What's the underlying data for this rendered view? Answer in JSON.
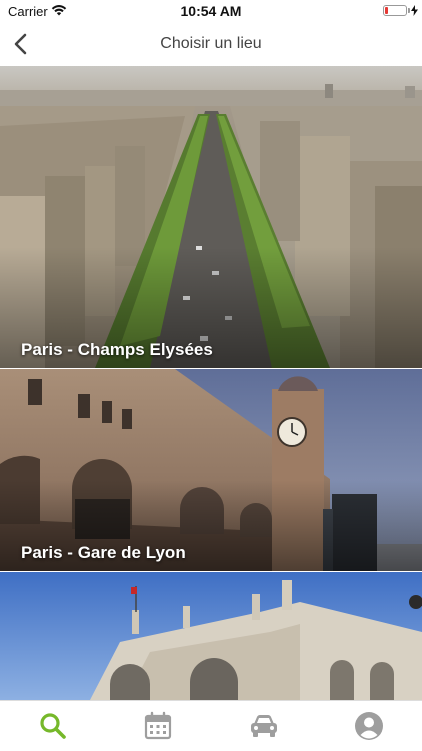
{
  "status_bar": {
    "carrier": "Carrier",
    "time": "10:54 AM",
    "battery_level": 0.1
  },
  "nav": {
    "title": "Choisir un lieu",
    "back_icon": "chevron-left-icon"
  },
  "places": [
    {
      "label": "Paris - Champs Elysées"
    },
    {
      "label": "Paris - Gare de Lyon"
    },
    {
      "label": ""
    }
  ],
  "tabs": [
    {
      "name": "search",
      "icon": "search-icon",
      "active": true
    },
    {
      "name": "calendar",
      "icon": "calendar-icon",
      "active": false
    },
    {
      "name": "car",
      "icon": "car-icon",
      "active": false
    },
    {
      "name": "profile",
      "icon": "profile-icon",
      "active": false
    }
  ],
  "colors": {
    "accent": "#76b82a",
    "tab_inactive": "#9e9e9e",
    "battery_low": "#e53935"
  }
}
